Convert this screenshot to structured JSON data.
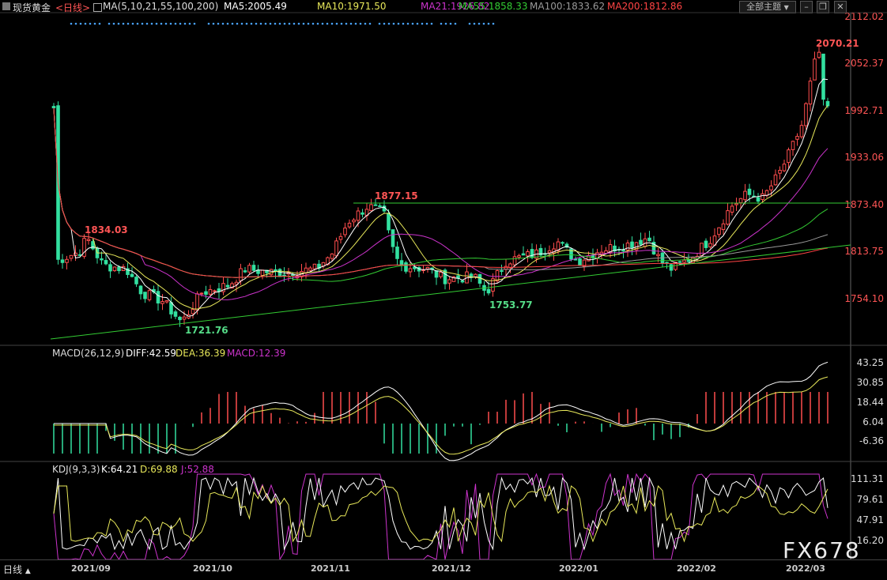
{
  "header": {
    "instrument": "现货黄金",
    "period": "<日线>",
    "ma_label": "MA(5,10,21,55,100,200)",
    "ma5": "MA5:2005.49",
    "ma10": "MA10:1971.50",
    "ma21": "MA21:1926.82",
    "ma55": "MA55:1858.33",
    "ma100": "MA100:1833.62",
    "ma200": "MA200:1812.86",
    "theme_button": "全部主题",
    "theme_arrow": "▼",
    "colors": {
      "ma5": "#ffffff",
      "ma10": "#e8e85a",
      "ma21": "#cc33cc",
      "ma55": "#33cc33",
      "ma100": "#999999",
      "ma200": "#ff4444"
    }
  },
  "window_controls": {
    "minimize": "–",
    "restore": "❐",
    "close": "✕"
  },
  "price_axis": [
    "2112.02",
    "2052.37",
    "1992.71",
    "1933.06",
    "1873.40",
    "1813.75",
    "1754.10"
  ],
  "price_annotations": {
    "high_nov": "1877.15",
    "high_sep": "1834.03",
    "low_sep": "1721.76",
    "low_dec": "1753.77",
    "high_mar": "2070.21"
  },
  "macd": {
    "label": "MACD(26,12,9)",
    "diff": "DIFF:42.59",
    "dea": "DEA:36.39",
    "macd": "MACD:12.39",
    "axis": [
      "43.25",
      "30.85",
      "18.44",
      "6.04",
      "-6.36"
    ]
  },
  "kdj": {
    "label": "KDJ(9,3,3)",
    "k": "K:64.21",
    "d": "D:69.88",
    "j": "J:52.88",
    "axis": [
      "111.31",
      "79.61",
      "47.91",
      "16.20"
    ]
  },
  "x_axis": [
    "2021/09",
    "2021/10",
    "2021/11",
    "2021/12",
    "2022/01",
    "2022/02",
    "2022/03"
  ],
  "bottom_tab": {
    "label": "日线",
    "arrow": "▲"
  },
  "watermark": "FX678",
  "chart_data": {
    "type": "candlestick",
    "series_notes": "daily spot gold, Aug 2021 - Mar 2022",
    "ylim": [
      1700,
      2112.02
    ],
    "key_levels": {
      "resistance": 1877.15,
      "peak": 2070.21
    },
    "last_close_approx": 1995
  }
}
